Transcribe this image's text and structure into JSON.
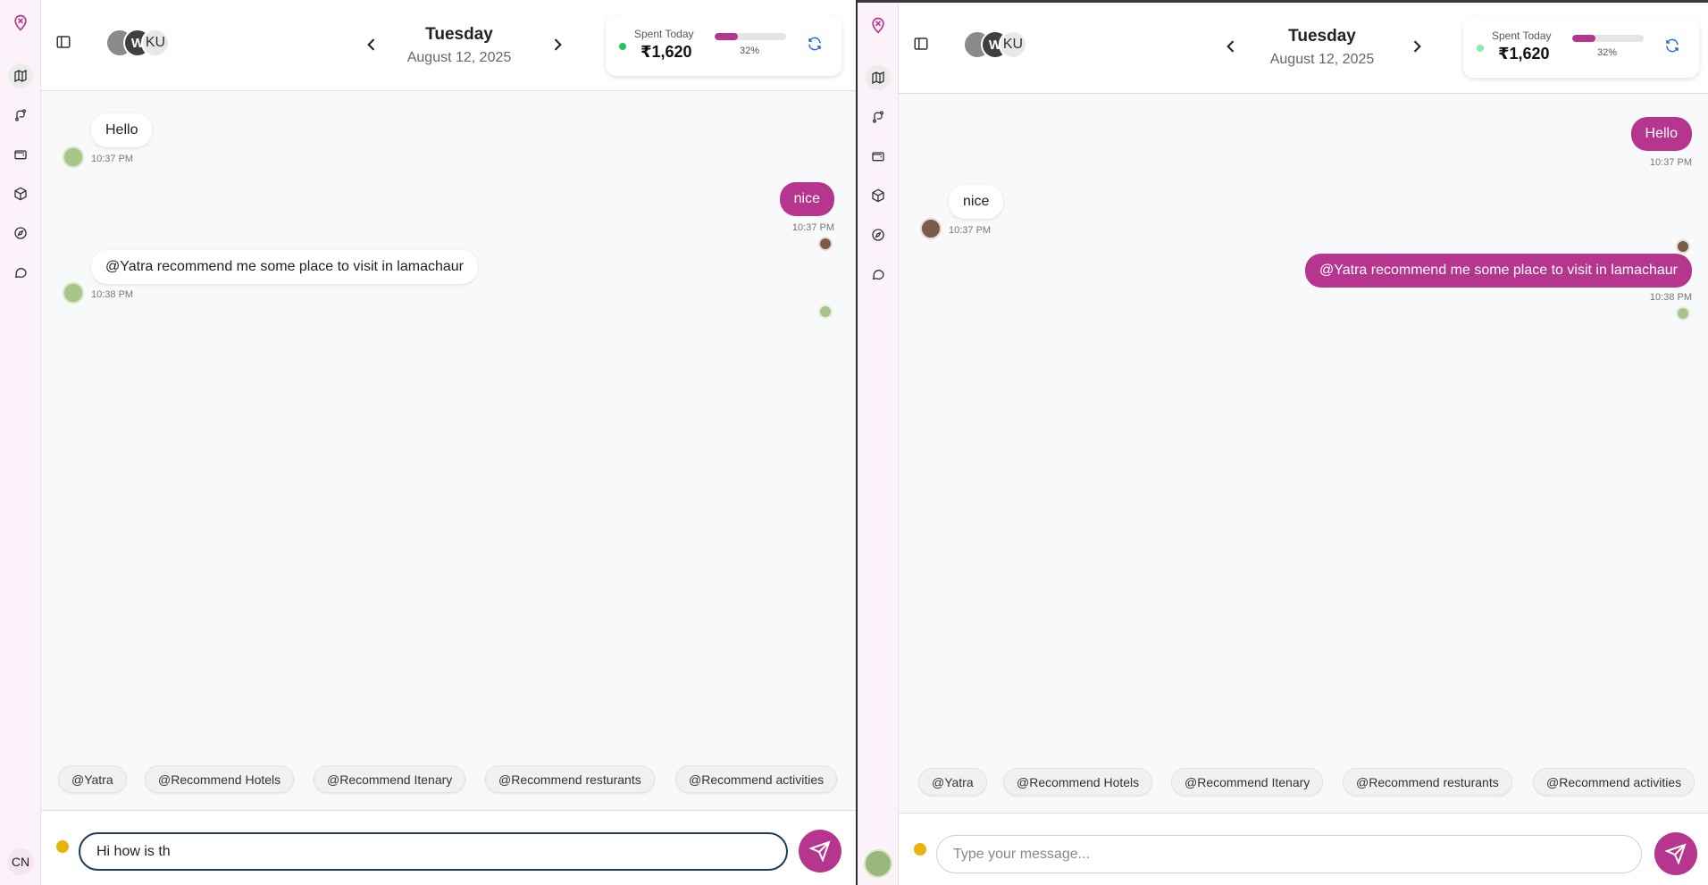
{
  "header": {
    "avatar_initials_w": "W",
    "avatar_initials_ku": "KU",
    "day": "Tuesday",
    "date": "August 12, 2025",
    "spent_label": "Spent Today",
    "spent_amount": "₹1,620",
    "spent_percent_label": "32%",
    "spent_fraction": 0.32
  },
  "rail": {
    "icons": [
      "logo-pin-icon",
      "map-icon",
      "route-icon",
      "wallet-icon",
      "package-icon",
      "compass-icon",
      "chat-icon"
    ],
    "left_user_initials": "CN"
  },
  "left_chat": {
    "messages": [
      {
        "text": "Hello",
        "time": "10:37 PM",
        "side": "in"
      },
      {
        "text": "nice",
        "time": "10:37 PM",
        "side": "out"
      },
      {
        "text": "@Yatra recommend me some place to visit in lamachaur",
        "time": "10:38 PM",
        "side": "in"
      }
    ]
  },
  "right_chat": {
    "messages": [
      {
        "text": "Hello",
        "time": "10:37 PM",
        "side": "out"
      },
      {
        "text": "nice",
        "time": "10:37 PM",
        "side": "in"
      },
      {
        "text": "@Yatra recommend me some place to visit in lamachaur",
        "time": "10:38 PM",
        "side": "out"
      }
    ]
  },
  "chips": [
    "@Yatra",
    "@Recommend Hotels",
    "@Recommend Itenary",
    "@Recommend resturants",
    "@Recommend activities"
  ],
  "composer": {
    "left_value": "Hi how is th",
    "placeholder": "Type your message...",
    "right_value": ""
  },
  "colors": {
    "accent": "#b5358f",
    "online": "#22c55e",
    "status_away": "#eab308",
    "refresh": "#2563eb"
  }
}
